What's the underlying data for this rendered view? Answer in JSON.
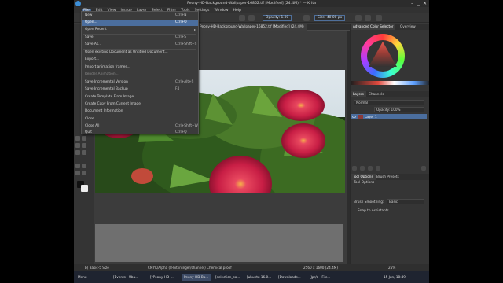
{
  "window": {
    "title": "Peony-HD-Background-Wallpaper-16852.tif [Modified] (24.4M) * — Krita",
    "close_glyph": "✕",
    "minimize_glyph": "–",
    "maximize_glyph": "□"
  },
  "menubar": [
    "File",
    "Edit",
    "View",
    "Image",
    "Layer",
    "Select",
    "Filter",
    "Tools",
    "Settings",
    "Window",
    "Help"
  ],
  "toolbar": {
    "opacity": "Opacity: 1.00",
    "size": "Size: 40.00 px"
  },
  "document_tab": "Peony-HD-Background-Wallpaper-16852.tif [Modified] (24.4M)",
  "file_menu": {
    "items": [
      {
        "label": "New",
        "shortcut": "Ctrl+N",
        "state": "normal"
      },
      {
        "label": "Open...",
        "shortcut": "Ctrl+O",
        "state": "highlight"
      },
      {
        "label": "Open Recent",
        "shortcut": "",
        "state": "submenu"
      },
      {
        "label": "Save",
        "shortcut": "Ctrl+S",
        "state": "normal"
      },
      {
        "label": "Save As...",
        "shortcut": "Ctrl+Shift+S",
        "state": "normal"
      },
      {
        "label": "Open existing Document as Untitled Document...",
        "shortcut": "",
        "state": "normal"
      },
      {
        "label": "Export...",
        "shortcut": "",
        "state": "normal"
      },
      {
        "label": "Import animation frames...",
        "shortcut": "",
        "state": "normal"
      },
      {
        "label": "Render Animation...",
        "shortcut": "",
        "state": "disabled"
      },
      {
        "label": "Save Incremental Version",
        "shortcut": "Ctrl+Alt+S",
        "state": "normal"
      },
      {
        "label": "Save Incremental Backup",
        "shortcut": "F4",
        "state": "normal"
      },
      {
        "label": "Create Template From Image...",
        "shortcut": "",
        "state": "normal"
      },
      {
        "label": "Create Copy From Current Image",
        "shortcut": "",
        "state": "normal"
      },
      {
        "label": "Document Information",
        "shortcut": "",
        "state": "normal"
      },
      {
        "label": "Close",
        "shortcut": "",
        "state": "normal"
      },
      {
        "label": "Close All",
        "shortcut": "Ctrl+Shift+W",
        "state": "normal"
      },
      {
        "label": "Quit",
        "shortcut": "Ctrl+Q",
        "state": "normal"
      }
    ],
    "submenu_arrow": "▸"
  },
  "right_panel": {
    "color_tabs": [
      "Advanced Color Selector",
      "Overview"
    ],
    "layer_tabs": [
      "Layers",
      "Channels"
    ],
    "blend_mode": "Normal",
    "opacity": "Opacity: 100%",
    "layer_name": "Layer 1",
    "tool_tabs": [
      "Tool Options",
      "Brush Presets"
    ],
    "tool_options_title": "Tool Options",
    "brush_smoothing_label": "Brush Smoothing:",
    "brush_smoothing_value": "Basic",
    "snap_label": "Snap to Assistants"
  },
  "statusbar": {
    "brush": "b) Basic-5 Size",
    "color": "CMYK/Alpha (8-bit integer/channel) Chemical proof",
    "dimensions": "2560 x 1600 (24.4M)",
    "zoom": "25%"
  },
  "taskbar": {
    "tasks": [
      "Menu",
      "[Events - Ubu...",
      "[*Peony-HD-...",
      "Peony-HD-Ba...",
      "[selection_so...",
      "[ubuntu 16.0...",
      "[Downloads...",
      "[Jpr/a - File..."
    ],
    "active_index": 3,
    "clock": "15 Jun, 18:49"
  },
  "colors": {
    "accent": "#4b6e9e",
    "panel": "#353535",
    "canvas": "#3c3c3c",
    "menu_bg": "#3b3b3b"
  }
}
